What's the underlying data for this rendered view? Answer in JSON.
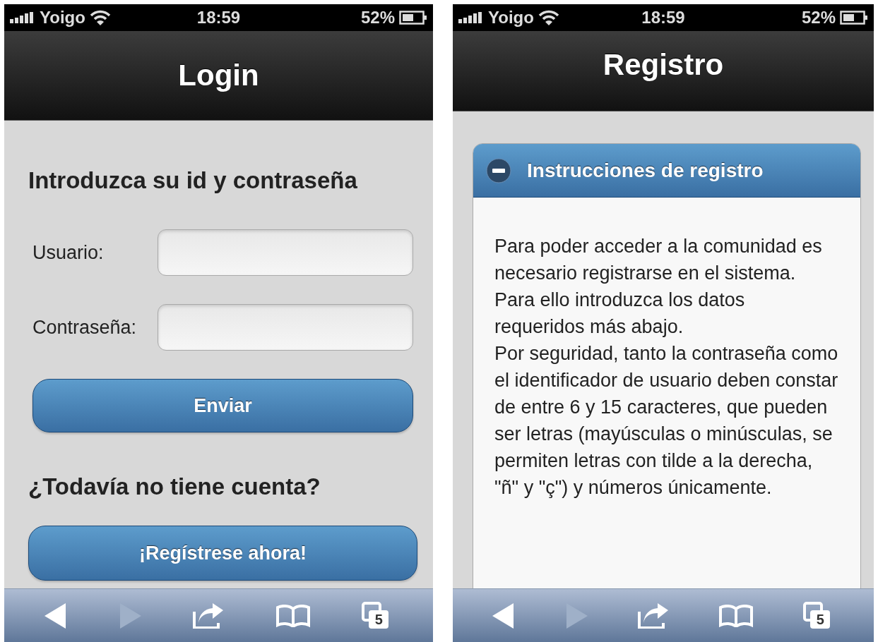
{
  "screens": [
    {
      "status_bar": {
        "carrier": "Yoigo",
        "time": "18:59",
        "battery": "52%"
      },
      "header": {
        "title": "Login"
      },
      "content": {
        "kind": "login",
        "heading": "Introduzca su id y contraseña",
        "fields": [
          {
            "label": "Usuario:"
          },
          {
            "label": "Contraseña:"
          }
        ],
        "submit": "Enviar",
        "subheading": "¿Todavía no tiene cuenta?",
        "register": "¡Regístrese ahora!"
      },
      "toolbar": {
        "back_disabled": false,
        "forward_disabled": true,
        "tab_count": "5"
      }
    },
    {
      "status_bar": {
        "carrier": "Yoigo",
        "time": "18:59",
        "battery": "52%"
      },
      "header": {
        "title": "Registro"
      },
      "content": {
        "kind": "collapsible",
        "title": "Instrucciones de registro",
        "expanded": true,
        "paragraphs": [
          "Para poder acceder a la comunidad es necesario registrarse en el sistema. Para ello introduzca los datos requeridos más abajo.",
          "Por seguridad, tanto la contraseña como el identificador de usuario deben constar de entre 6 y 15 caracteres, que pueden ser letras (mayúsculas o minúsculas, se permiten letras con tilde a la derecha, \"ñ\" y \"ç\") y números únicamente."
        ]
      },
      "toolbar": {
        "back_disabled": false,
        "forward_disabled": true,
        "tab_count": "5"
      }
    }
  ]
}
